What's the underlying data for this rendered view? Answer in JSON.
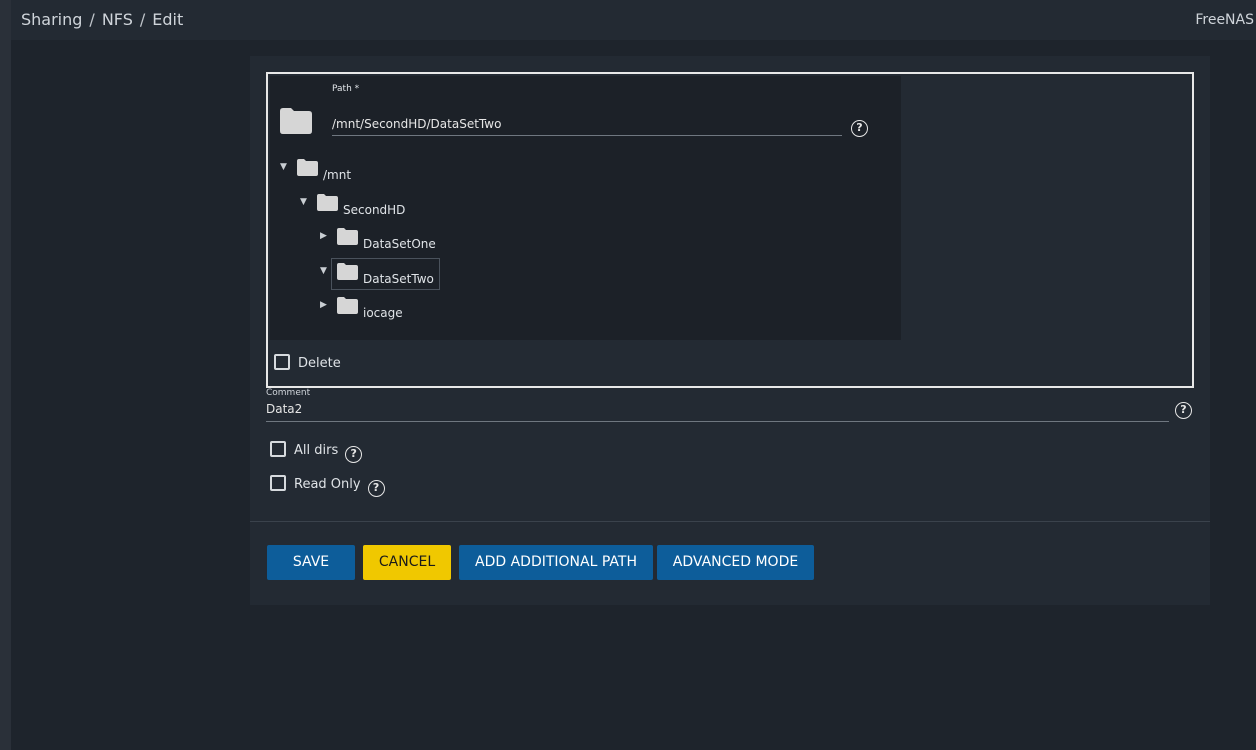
{
  "header": {
    "breadcrumb": [
      "Sharing",
      "NFS",
      "Edit"
    ],
    "separator": "/",
    "brand": "FreeNAS"
  },
  "form": {
    "path": {
      "label": "Path *",
      "value": "/mnt/SecondHD/DataSetTwo",
      "help_icon": "help-circle-icon"
    },
    "tree": [
      {
        "label": "/mnt",
        "expanded": true,
        "arrow": "▼"
      },
      {
        "label": "SecondHD",
        "expanded": true,
        "arrow": "▼"
      },
      {
        "label": "DataSetOne",
        "expanded": false,
        "arrow": "▶"
      },
      {
        "label": "DataSetTwo",
        "expanded": true,
        "arrow": "▼",
        "selected": true
      },
      {
        "label": "iocage",
        "expanded": false,
        "arrow": "▶"
      }
    ],
    "delete_label": "Delete",
    "comment": {
      "label": "Comment",
      "value": "Data2"
    },
    "all_dirs_label": "All dirs",
    "read_only_label": "Read Only"
  },
  "buttons": {
    "save": "SAVE",
    "cancel": "CANCEL",
    "add_path": "ADD ADDITIONAL PATH",
    "advanced": "ADVANCED MODE"
  },
  "colors": {
    "primary": "#0d5d9a",
    "warn": "#f0c800",
    "background": "#1e242c",
    "card": "#232a33"
  }
}
